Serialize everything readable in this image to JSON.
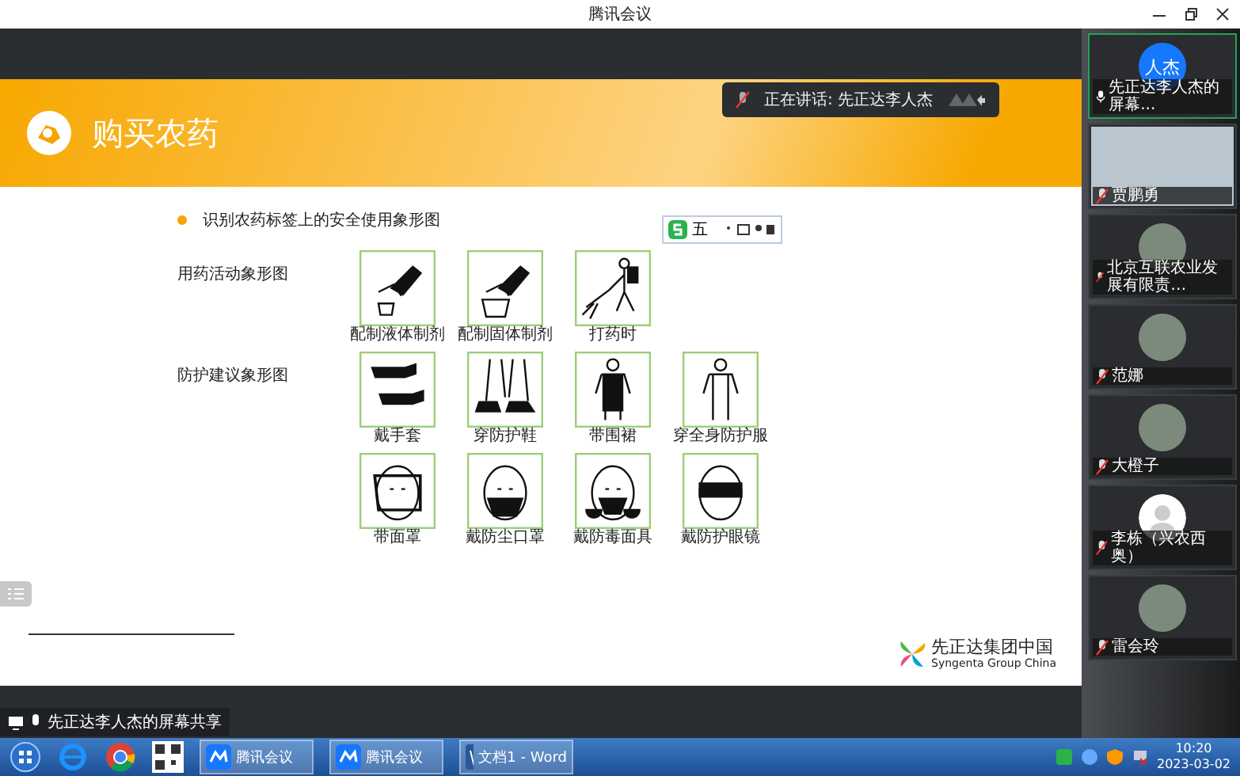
{
  "window": {
    "title": "腾讯会议"
  },
  "slide": {
    "title": "购买农药",
    "bullet": "识别农药标签上的安全使用象形图",
    "ime_mode": "五",
    "groups": [
      {
        "label": "用药活动象形图",
        "items": [
          {
            "kind": "liquid",
            "caption": "配制液体制剂"
          },
          {
            "kind": "solid",
            "caption": "配制固体制剂"
          },
          {
            "kind": "spraying",
            "caption": "打药时"
          }
        ]
      },
      {
        "label": "防护建议象形图",
        "items": [
          {
            "kind": "gloves",
            "caption": "戴手套"
          },
          {
            "kind": "boots",
            "caption": "穿防护鞋"
          },
          {
            "kind": "apron",
            "caption": "带围裙"
          },
          {
            "kind": "coverall",
            "caption": "穿全身防护服"
          },
          {
            "kind": "face-shield",
            "caption": "带面罩"
          },
          {
            "kind": "dust-mask",
            "caption": "戴防尘口罩"
          },
          {
            "kind": "respirator",
            "caption": "戴防毒面具"
          },
          {
            "kind": "goggles",
            "caption": "戴防护眼镜"
          }
        ]
      }
    ],
    "logo": {
      "name": "先正达集团中国",
      "subtitle": "Syngenta Group China"
    }
  },
  "speaking": {
    "label": "正在讲话: 先正达李人杰"
  },
  "share_label": "先正达李人杰的屏幕共享",
  "participants": [
    {
      "name": "先正达李人杰的屏幕...",
      "kind": "initials",
      "avatar_text": "人杰",
      "muted": false,
      "speaking": true
    },
    {
      "name": "贾鹏勇",
      "kind": "video",
      "muted": true,
      "speaking": false
    },
    {
      "name": "北京互联农业发展有限责…",
      "kind": "photo",
      "muted": true,
      "speaking": false
    },
    {
      "name": "范娜",
      "kind": "photo",
      "muted": true,
      "speaking": false
    },
    {
      "name": "大橙子",
      "kind": "photo",
      "muted": true,
      "speaking": false
    },
    {
      "name": "李栋（兴农西奥）",
      "kind": "default",
      "muted": true,
      "speaking": false
    },
    {
      "name": "雷会玲",
      "kind": "photo",
      "muted": true,
      "speaking": false
    }
  ],
  "taskbar": {
    "apps": [
      {
        "kind": "meeting",
        "label": "腾讯会议"
      },
      {
        "kind": "meeting",
        "label": "腾讯会议"
      },
      {
        "kind": "word",
        "label": "文档1 - Word"
      }
    ],
    "time": "10:20",
    "date": "2023-03-02"
  }
}
